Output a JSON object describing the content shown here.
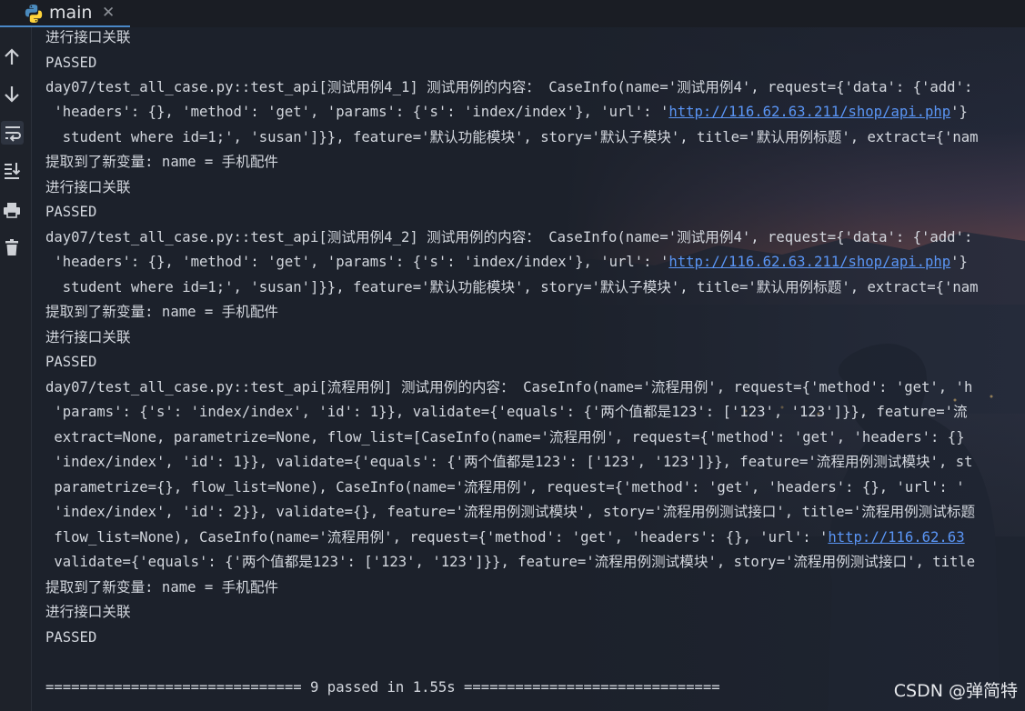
{
  "tab": {
    "label": "main",
    "icon": "python-icon",
    "close_icon": "close-icon"
  },
  "toolbar": {
    "items": [
      {
        "icon": "arrow-up-icon"
      },
      {
        "icon": "arrow-down-icon"
      },
      {
        "icon": "soft-wrap-icon"
      },
      {
        "icon": "scroll-to-end-icon"
      },
      {
        "icon": "print-icon"
      },
      {
        "icon": "trash-icon"
      }
    ]
  },
  "console": {
    "lines": [
      {
        "text": "进行接口关联"
      },
      {
        "text": "PASSED"
      },
      {
        "text": "day07/test_all_case.py::test_api[测试用例4_1] 测试用例的内容： CaseInfo(name='测试用例4', request={'data': {'add':"
      },
      {
        "pre": " 'headers': {}, 'method': 'get', 'params': {'s': 'index/index'}, 'url': '",
        "link": "http://116.62.63.211/shop/api.php",
        "post": "'}"
      },
      {
        "text": "  student where id=1;', 'susan']}}, feature='默认功能模块', story='默认子模块', title='默认用例标题', extract={'nam"
      },
      {
        "text": "提取到了新变量: name = 手机配件"
      },
      {
        "text": "进行接口关联"
      },
      {
        "text": "PASSED"
      },
      {
        "text": "day07/test_all_case.py::test_api[测试用例4_2] 测试用例的内容： CaseInfo(name='测试用例4', request={'data': {'add':"
      },
      {
        "pre": " 'headers': {}, 'method': 'get', 'params': {'s': 'index/index'}, 'url': '",
        "link": "http://116.62.63.211/shop/api.php",
        "post": "'}"
      },
      {
        "text": "  student where id=1;', 'susan']}}, feature='默认功能模块', story='默认子模块', title='默认用例标题', extract={'nam"
      },
      {
        "text": "提取到了新变量: name = 手机配件"
      },
      {
        "text": "进行接口关联"
      },
      {
        "text": "PASSED"
      },
      {
        "text": "day07/test_all_case.py::test_api[流程用例] 测试用例的内容： CaseInfo(name='流程用例', request={'method': 'get', 'h"
      },
      {
        "text": " 'params': {'s': 'index/index', 'id': 1}}, validate={'equals': {'两个值都是123': ['123', '123']}}, feature='流"
      },
      {
        "text": " extract=None, parametrize=None, flow_list=[CaseInfo(name='流程用例', request={'method': 'get', 'headers': {}"
      },
      {
        "text": " 'index/index', 'id': 1}}, validate={'equals': {'两个值都是123': ['123', '123']}}, feature='流程用例测试模块', st"
      },
      {
        "text": " parametrize={}, flow_list=None), CaseInfo(name='流程用例', request={'method': 'get', 'headers': {}, 'url': '"
      },
      {
        "text": " 'index/index', 'id': 2}}, validate={}, feature='流程用例测试模块', story='流程用例测试接口', title='流程用例测试标题"
      },
      {
        "pre": " flow_list=None), CaseInfo(name='流程用例', request={'method': 'get', 'headers': {}, 'url': '",
        "link": "http://116.62.63",
        "post": ""
      },
      {
        "text": " validate={'equals': {'两个值都是123': ['123', '123']}}, feature='流程用例测试模块', story='流程用例测试接口', title"
      },
      {
        "text": "提取到了新变量: name = 手机配件"
      },
      {
        "text": "进行接口关联"
      },
      {
        "text": "PASSED"
      },
      {
        "text": ""
      },
      {
        "text": "============================== 9 passed in 1.55s =============================="
      }
    ]
  },
  "watermark": "CSDN @弹简特",
  "colors": {
    "background": "#1c212b",
    "text": "#d3d7de",
    "link": "#5a95f5",
    "tab_underline": "#4a88c7"
  }
}
